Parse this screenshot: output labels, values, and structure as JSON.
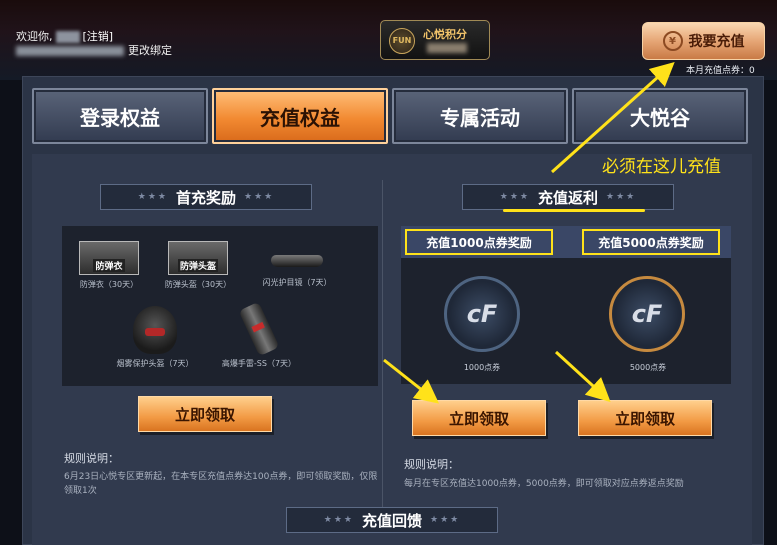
{
  "header": {
    "welcome_prefix": "欢迎你,",
    "logout": "[注销]",
    "change_binding": "更改绑定",
    "points_label": "心悦积分",
    "fun_icon": "fun-logo-icon",
    "recharge_button": "我要充值",
    "month_recharge": "本月充值点券：0"
  },
  "tabs": [
    {
      "label": "登录权益",
      "active": false
    },
    {
      "label": "充值权益",
      "active": true
    },
    {
      "label": "专属活动",
      "active": false
    },
    {
      "label": "大悦谷",
      "active": false
    }
  ],
  "first_recharge": {
    "title": "首充奖励",
    "items": [
      {
        "name": "防弹衣（30天）",
        "tag": "防弹衣"
      },
      {
        "name": "防弹头盔（30天）",
        "tag": "防弹头盔"
      },
      {
        "name": "闪光护目镜（7天）"
      },
      {
        "name": "烟雾保护头盔（7天）"
      },
      {
        "name": "高爆手雷-SS（7天）"
      }
    ],
    "claim_button": "立即领取",
    "rules_label": "规则说明：",
    "rules_text": "6月23日心悦专区更新起，在本专区充值点券达100点券，即可领取奖励，仅限领取1次"
  },
  "rebate": {
    "title": "充值返利",
    "tier1_title": "充值1000点券奖励",
    "tier2_title": "充值5000点券奖励",
    "tier1_coupon": "1000点券",
    "tier2_coupon": "5000点券",
    "claim_button": "立即领取",
    "rules_label": "规则说明：",
    "rules_text": "每月在专区充值达1000点券，5000点券，即可领取对应点券返点奖励"
  },
  "feedback_title": "充值回馈",
  "annotation": "必须在这儿充值",
  "colors": {
    "accent_orange": "#f28a32",
    "highlight_yellow": "#ffe21a",
    "panel": "#313a4e"
  }
}
